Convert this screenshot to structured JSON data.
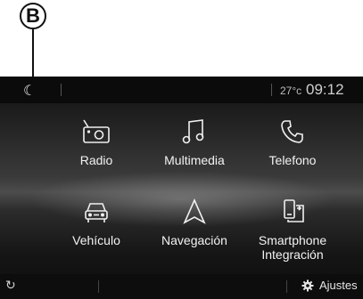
{
  "callout": {
    "letter": "B"
  },
  "status": {
    "temperature": "27°c",
    "time": "09:12",
    "moon_icon": "moon-icon"
  },
  "tiles": [
    {
      "label": "Radio",
      "icon": "radio-icon"
    },
    {
      "label": "Multimedia",
      "icon": "music-note-icon"
    },
    {
      "label": "Telefono",
      "icon": "phone-icon"
    },
    {
      "label": "Vehículo",
      "icon": "car-icon"
    },
    {
      "label": "Navegación",
      "icon": "navigation-arrow-icon"
    },
    {
      "label": "Smartphone Integración",
      "icon": "smartphone-icon"
    }
  ],
  "bottom": {
    "settings_label": "Ajustes"
  },
  "colors": {
    "background": "#0e0e0e",
    "text": "#f2f2f2"
  }
}
